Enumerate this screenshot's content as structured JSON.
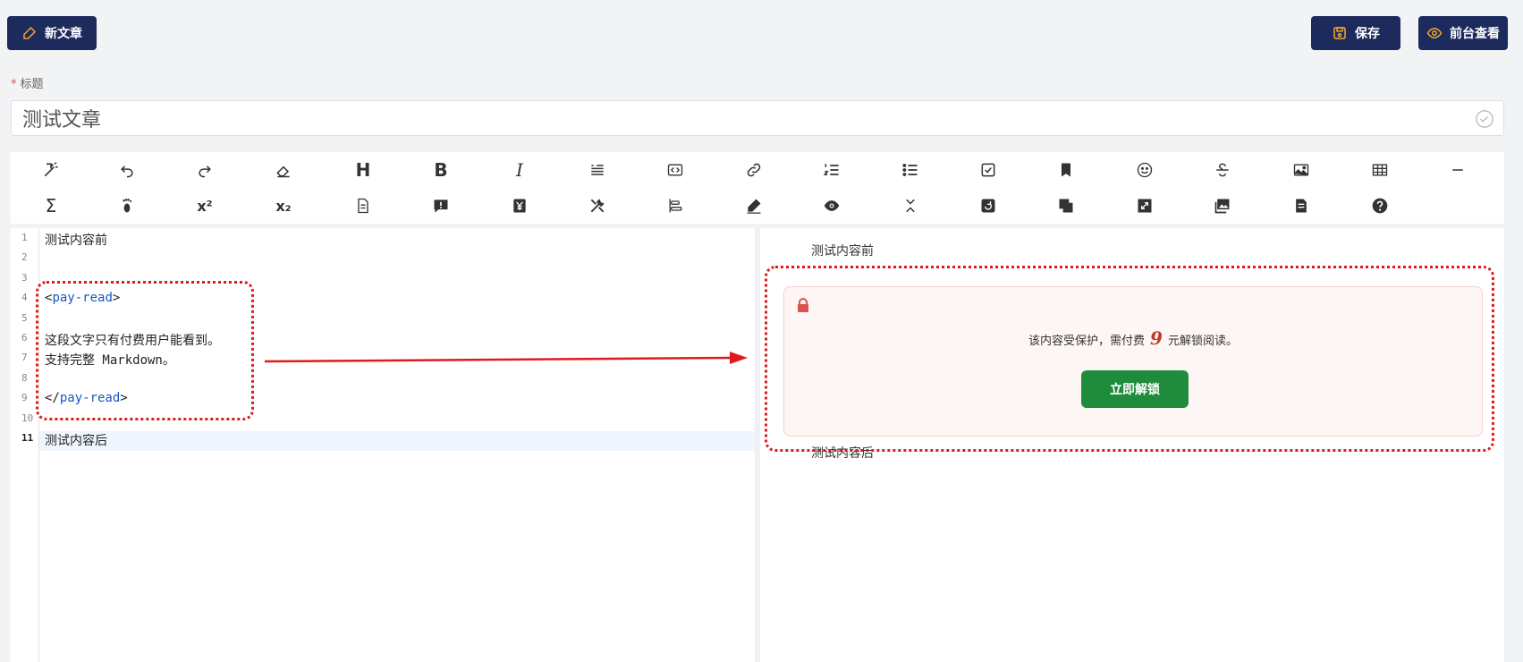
{
  "topbar": {
    "new_label": "新文章",
    "save_label": "保存",
    "preview_label": "前台查看"
  },
  "title_field": {
    "required_mark": "*",
    "label": "标题",
    "value": "测试文章"
  },
  "toolbar": {
    "row1": [
      "magic-wand-icon",
      "undo-icon",
      "redo-icon",
      "eraser-icon",
      "heading-icon",
      "bold-icon",
      "italic-icon",
      "quote-icon",
      "code-icon",
      "link-icon",
      "ordered-list-icon",
      "unordered-list-icon",
      "checkbox-icon",
      "bookmark-icon",
      "emoji-icon",
      "strikethrough-icon",
      "image-icon",
      "table-icon",
      "horizontal-rule-icon"
    ],
    "row2": [
      "sigma-icon",
      "footnote-icon",
      "superscript-icon",
      "subscript-icon",
      "file-icon",
      "comment-alert-icon",
      "yen-icon",
      "tools-icon",
      "align-icon",
      "pencil-icon",
      "eye-icon",
      "collapse-icon",
      "rotate-icon",
      "copy-icon",
      "expand-icon",
      "gallery-icon",
      "document-icon",
      "help-icon"
    ],
    "heading_glyph": "H",
    "bold_glyph": "B",
    "italic_glyph": "I",
    "sigma_glyph": "Σ",
    "sup_glyph": "x²",
    "sub_glyph": "x₂"
  },
  "editor": {
    "line_numbers": [
      "1",
      "2",
      "3",
      "4",
      "5",
      "6",
      "7",
      "8",
      "9",
      "10",
      "11"
    ],
    "lines": {
      "l1": "测试内容前",
      "l4_open": "<",
      "l4_tag": "pay-read",
      "l4_close": ">",
      "l6": "这段文字只有付费用户能看到。",
      "l7": "支持完整 Markdown。",
      "l9_open": "</",
      "l9_tag": "pay-read",
      "l9_close": ">",
      "l11": "测试内容后"
    },
    "active_line": 11
  },
  "preview": {
    "before_text": "测试内容前",
    "after_text": "测试内容后",
    "paywall": {
      "msg_before": "该内容受保护，需付费",
      "price": "9",
      "msg_after": "元解锁阅读。",
      "button_label": "立即解锁"
    }
  },
  "colors": {
    "brand_dark": "#1d2a5c",
    "annotation_red": "#e01a1a",
    "unlock_green": "#1f8b3c",
    "price_red": "#c0392b",
    "tag_blue": "#1a56c2"
  }
}
